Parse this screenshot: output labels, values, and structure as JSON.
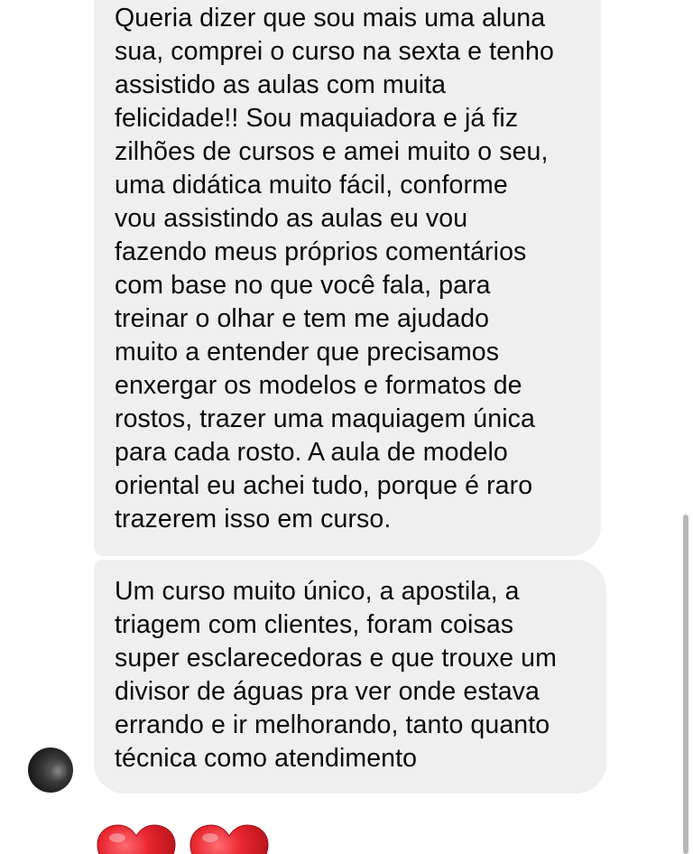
{
  "messages": [
    {
      "text": "Queria dizer que sou mais uma aluna\nsua, comprei o curso na sexta e tenho\nassistido as aulas com muita\nfelicidade!! Sou maquiadora e já fiz\nzilhões de cursos e amei muito o seu,\numa didática muito fácil, conforme\nvou assistindo as aulas eu vou\nfazendo meus próprios comentários\ncom base no que você fala, para\ntreinar o olhar e tem me ajudado\nmuito a entender que precisamos\nenxergar os modelos e formatos de\nrostos, trazer uma maquiagem única\npara cada rosto. A aula de modelo\noriental eu achei tudo, porque é raro\ntrazerem isso em curso."
    },
    {
      "text": "Um curso muito único, a apostila, a\ntriagem com clientes, foram coisas\nsuper esclarecedoras e que trouxe um\ndivisor de águas pra ver onde estava\nerrando e ir melhorando, tanto quanto\ntécnica como atendimento"
    }
  ],
  "reactions": [
    "red-heart",
    "red-heart"
  ],
  "colors": {
    "bubble": "#efefef",
    "text": "#0a0a0a",
    "heart": "#e0242f",
    "background": "#ffffff"
  }
}
